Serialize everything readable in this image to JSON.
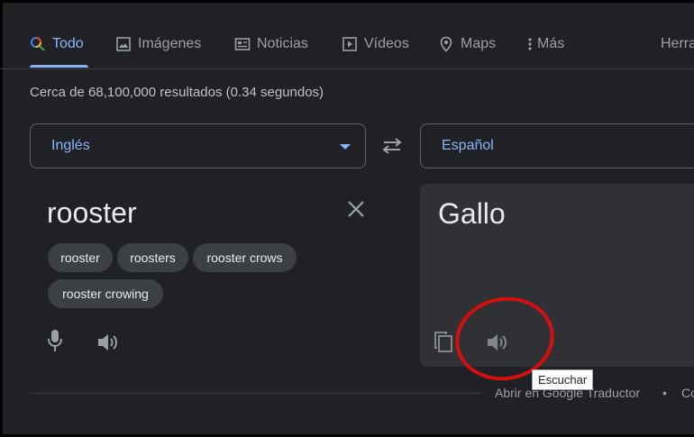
{
  "nav": {
    "tabs": [
      {
        "label": "Todo",
        "icon": "search-icon"
      },
      {
        "label": "Imágenes",
        "icon": "image-icon"
      },
      {
        "label": "Noticias",
        "icon": "news-icon"
      },
      {
        "label": "Vídeos",
        "icon": "video-icon"
      },
      {
        "label": "Maps",
        "icon": "map-pin-icon"
      },
      {
        "label": "Más",
        "icon": "more-vert-icon"
      }
    ],
    "tools": "Herra"
  },
  "results_text": "Cerca de 68,100,000 resultados (0.34 segundos)",
  "translator": {
    "source_language": "Inglés",
    "target_language": "Español",
    "source_text": "rooster",
    "translated_text": "Gallo",
    "suggestions": [
      "rooster",
      "roosters",
      "rooster crows",
      "rooster crowing"
    ],
    "tooltip": "Escuchar"
  },
  "footer": {
    "open_link": "Abrir en Google Traductor",
    "separator": "•",
    "feedback": "Co"
  },
  "colors": {
    "background": "#202124",
    "accent": "#8ab4f8",
    "panel": "#303134",
    "annotation_ring": "#d50f0f"
  }
}
